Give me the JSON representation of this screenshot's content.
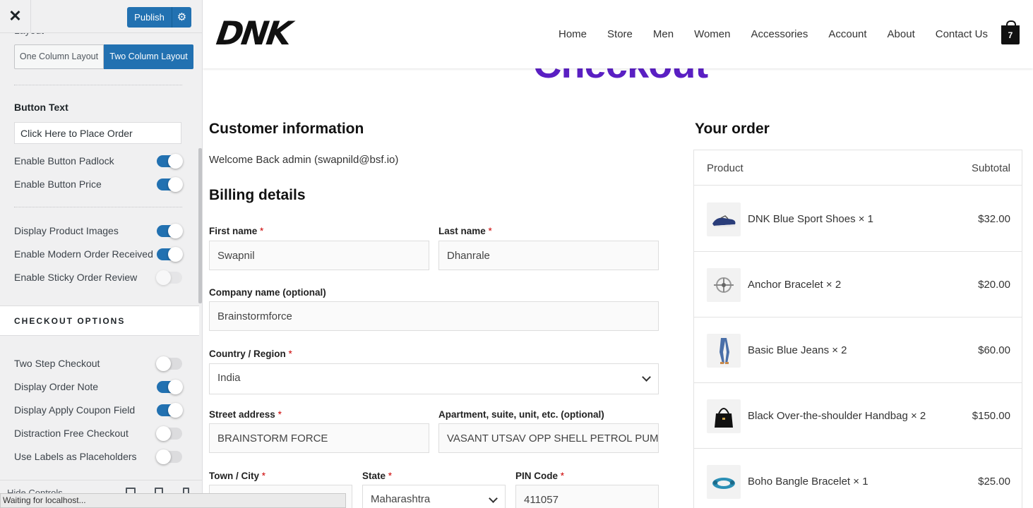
{
  "sidebar": {
    "close_icon": "close-icon",
    "publish_label": "Publish",
    "publish_settings_icon": "gear-icon",
    "cut_label": "Layout",
    "layout_options": [
      "One Column Layout",
      "Two Column Layout"
    ],
    "layout_selected": "Two Column Layout",
    "button_text_heading": "Button Text",
    "button_text_value": "Click Here to Place Order",
    "toggles_group1": [
      {
        "label": "Enable Button Padlock",
        "on": true
      },
      {
        "label": "Enable Button Price",
        "on": true
      }
    ],
    "toggles_group2": [
      {
        "label": "Display Product Images",
        "on": true
      },
      {
        "label": "Enable Modern Order Received",
        "on": true
      },
      {
        "label": "Enable Sticky Order Review",
        "on": false
      }
    ],
    "section_title": "CHECKOUT OPTIONS",
    "toggles_group3": [
      {
        "label": "Two Step Checkout",
        "on": false
      },
      {
        "label": "Display Order Note",
        "on": true
      },
      {
        "label": "Display Apply Coupon Field",
        "on": true
      },
      {
        "label": "Distraction Free Checkout",
        "on": false
      },
      {
        "label": "Use Labels as Placeholders",
        "on": false
      }
    ],
    "footer_label": "Hide Controls",
    "status_text": "Waiting for localhost..."
  },
  "site": {
    "logo": "DNK",
    "nav": [
      "Home",
      "Store",
      "Men",
      "Women",
      "Accessories",
      "Account",
      "About",
      "Contact Us"
    ],
    "cart_count": "7",
    "page_title": "Checkout"
  },
  "checkout": {
    "customer_heading": "Customer information",
    "welcome": "Welcome Back admin (swapnild@bsf.io)",
    "billing_heading": "Billing details",
    "first_name_label": "First name",
    "first_name": "Swapnil",
    "last_name_label": "Last name",
    "last_name": "Dhanrale",
    "company_label": "Company name (optional)",
    "company": "Brainstormforce",
    "country_label": "Country / Region",
    "country": "India",
    "street_label": "Street address",
    "street": "BRAINSTORM FORCE",
    "apartment_label": "Apartment, suite, unit, etc. (optional)",
    "apartment": "VASANT UTSAV OPP SHELL PETROL PUMP",
    "town_label": "Town / City",
    "town": "",
    "state_label": "State",
    "state": "Maharashtra",
    "pin_label": "PIN Code",
    "pin": "411057",
    "required_mark": "*"
  },
  "order": {
    "heading": "Your order",
    "col_product": "Product",
    "col_subtotal": "Subtotal",
    "items": [
      {
        "name": "DNK Blue Sport Shoes × 1",
        "price": "$32.00"
      },
      {
        "name": "Anchor Bracelet × 2",
        "price": "$20.00"
      },
      {
        "name": "Basic Blue Jeans × 2",
        "price": "$60.00"
      },
      {
        "name": "Black Over-the-shoulder Handbag × 2",
        "price": "$150.00"
      },
      {
        "name": "Boho Bangle Bracelet × 1",
        "price": "$25.00"
      }
    ]
  },
  "colors": {
    "wp_blue": "#2271b1",
    "title_purple": "#5a1fc3",
    "required_red": "#cc0000"
  }
}
